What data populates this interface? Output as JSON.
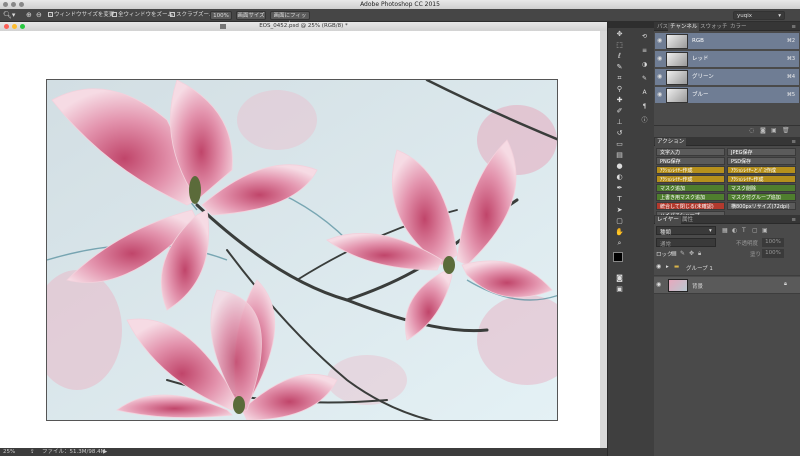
{
  "app": {
    "title": "Adobe Photoshop CC 2015"
  },
  "options_bar": {
    "zoom_tool_icon": "magnifier-icon",
    "resize_windows": "ウィンドウサイズを変更",
    "zoom_all": "全ウィンドウをズーム",
    "scrubby_zoom": "スクラブズーム",
    "btn_100": "100%",
    "btn_fit": "画面サイズ",
    "btn_fill": "画面にフィット",
    "workspace": "yuqix"
  },
  "document": {
    "title": "EOS_0452.psd @ 25% (RGB/8) *",
    "zoom": "25%",
    "file_info": "ファイル：51.3M/98.4M"
  },
  "colors": {
    "channel_row": "#6f7d94",
    "action_yellow": "#b6901c",
    "action_green": "#4f7e2e",
    "action_red": "#b23a2e",
    "action_gray": "#5b5b5b"
  },
  "channels_panel": {
    "tabs": [
      "パス",
      "チャンネル",
      "スウォッチ",
      "カラー"
    ],
    "rows": [
      {
        "name": "RGB",
        "key": "⌘2"
      },
      {
        "name": "レッド",
        "key": "⌘3"
      },
      {
        "name": "グリーン",
        "key": "⌘4"
      },
      {
        "name": "ブルー",
        "key": "⌘5"
      }
    ]
  },
  "actions_panel": {
    "tab": "アクション",
    "buttons": [
      {
        "label": "文字入力",
        "color": "gray"
      },
      {
        "label": "JPEG保存",
        "color": "gray"
      },
      {
        "label": "PNG保存",
        "color": "gray"
      },
      {
        "label": "PSD保存",
        "color": "gray"
      },
      {
        "label": "ｱｸｼｮﾝﾚｲﾔｰ作成",
        "color": "yellow"
      },
      {
        "label": "ｱｸｼｮﾝﾚｲﾔｰとﾊﾟｽ作成",
        "color": "yellow"
      },
      {
        "label": "ｱｸｼｮﾝﾚｲﾔｰ作成",
        "color": "yellow"
      },
      {
        "label": "ｱｸｼｮﾝﾚｲﾔｰ作成",
        "color": "yellow"
      },
      {
        "label": "マスク追加",
        "color": "green"
      },
      {
        "label": "マスク削除",
        "color": "green"
      },
      {
        "label": "上書き用マスク追加",
        "color": "green"
      },
      {
        "label": "マスク付グループ追加",
        "color": "green"
      },
      {
        "label": "統合して閉じる(未確認)",
        "color": "red"
      },
      {
        "label": "横800pxリサイズ(72dpi)",
        "color": "gray"
      },
      {
        "label": "ハイパスシャープ",
        "color": "gray"
      }
    ]
  },
  "layers_panel": {
    "tabs": [
      "レイヤー",
      "属性"
    ],
    "filter": "種類",
    "blend_mode": "通常",
    "opacity_label": "不透明度",
    "opacity": "100%",
    "lock_label": "ロック",
    "fill_label": "塗り",
    "fill": "100%",
    "layers": [
      {
        "name": "グループ 1",
        "type": "group"
      },
      {
        "name": "背景",
        "type": "background"
      }
    ]
  },
  "toolbar": {
    "tools": [
      "move-icon",
      "marquee-icon",
      "lasso-icon",
      "quick-select-icon",
      "crop-icon",
      "eyedropper-icon",
      "healing-icon",
      "brush-icon",
      "stamp-icon",
      "history-brush-icon",
      "eraser-icon",
      "gradient-icon",
      "blur-icon",
      "dodge-icon",
      "pen-icon",
      "type-icon",
      "path-select-icon",
      "rectangle-icon",
      "hand-icon",
      "zoom-icon"
    ]
  }
}
